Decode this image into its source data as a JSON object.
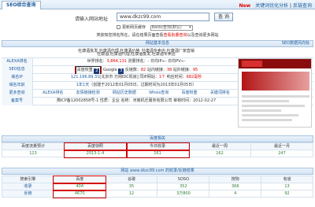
{
  "header": {
    "active_tab": "SEO综合查询",
    "new_label": "New",
    "link1": "关键词优化分析",
    "separator": "|",
    "link2": "反链查询"
  },
  "search": {
    "label": "请输入网站地址",
    "value": "www.dkzc99.com",
    "button": "查 询",
    "checkbox_label": "更新网页缓存",
    "select_value": "Baidu查询(默认)",
    "notice_prefix": "类获知您排名所在，请在结果页面查看",
    "notice_highlight": "查看批量查询",
    "notice_suffix": "以及查询更多网站"
  },
  "basic_bar": {
    "title": "网站基本信息",
    "right_link": "SEO数据风向标"
  },
  "info": {
    "alexa": {
      "label": "ALEXA排名",
      "world_rank_label": "世界排名：",
      "world_rank": "3,864,131",
      "traffic_label": "流量排名：",
      "traffic": "-",
      "daily_ip_label": "日均IP≈",
      "daily_ip": "-",
      "pv_label": "日均PV≈",
      "pv": "-"
    },
    "seo": {
      "label": "SEO信息",
      "baidu_weight": "百度权重",
      "baidu_value": "2",
      "google": "Google",
      "google_value": "3",
      "backlinks_label": "反链数：",
      "backlinks": "82",
      "inlinks_label": "站内链接：",
      "inlinks": "38",
      "outlinks_label": "站外链接：",
      "outlinks": "95"
    },
    "domain_ip": {
      "label": "域名IP",
      "ip": "121.196.89.31",
      "location": "[北京市 万网IDC机房]",
      "same_ip_label": "同IP网站：",
      "same_ip": "1个",
      "speed_label": "响应时间：",
      "speed": "682毫秒"
    },
    "domain_age": {
      "label": "域名年龄",
      "age": "1年1天",
      "detail": "（创建于2012年01月05日，过期时间为2013年01月05日）"
    },
    "more": {
      "label": "更多查询",
      "links": [
        "ALEXA排名",
        "友情链接检测",
        "网站历史数据",
        "Whois查询",
        "百度权重",
        "关键词排名"
      ]
    },
    "beian": {
      "label": "备案号",
      "number": "豫ICP备12002858号-1",
      "type_label": "性质：",
      "type": "企业",
      "name_label": "名称：",
      "name": "河南机迁服务有限公司",
      "time_label": "审核时间：",
      "time": "2012-02-27"
    },
    "title_text": "杜康酒批发,杜康酒代理,杜康酒价格_杜康酒专卖店-杜康酒厂家直销",
    "keyword_text": "杜康酒,杜康酒代理,杜康酒批发,杜康酒专卖店",
    "desc_text": "杜康酒是中华名酒,杜康酒代理批发,自酒批发"
  },
  "baidu_bar": {
    "title": "百度相关"
  },
  "baidu": {
    "headers": [
      "百度流量预计",
      "百度快照",
      "今日收录",
      "最近一周",
      "最近一月"
    ],
    "values": [
      "123",
      "2013-1-4",
      "161",
      "162",
      "247"
    ]
  },
  "search_bar": {
    "title": "网站 www.dkzc99.com 的收录/反链结果",
    "domain": "www.dkzc99.com"
  },
  "engines": {
    "headers": [
      "搜索引擎",
      "百度",
      "谷歌",
      "SOSO",
      "搜狗",
      "有道"
    ],
    "rows": [
      {
        "label": "收录",
        "values": [
          "404",
          "35",
          "352",
          "366",
          "13"
        ]
      },
      {
        "label": "反链",
        "values": [
          "4670",
          "12",
          "3万800",
          "4",
          "92"
        ]
      }
    ]
  },
  "colors": {
    "accent": "#1a5a9c",
    "highlight": "#d40000",
    "value_green": "#2e7d32"
  }
}
